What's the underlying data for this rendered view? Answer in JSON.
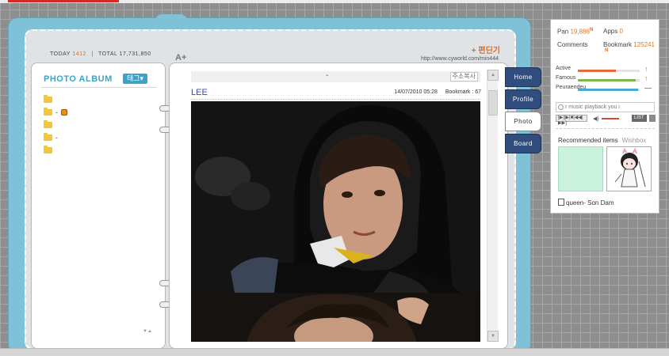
{
  "header": {
    "counter": {
      "today_label": "TODAY",
      "today_value": "1412",
      "total_label": "TOTAL",
      "total_value": "17,731,850"
    },
    "font_size_label": "A+",
    "edit_link": "+ 편딘기",
    "url": "http://www.cyworld.com/min444"
  },
  "album": {
    "title": "PHOTO ALBUM",
    "tag_button": "태그▾",
    "folders": [
      {
        "label": "",
        "icon": "folder-icon"
      },
      {
        "label": "-",
        "icon": "folder-icon",
        "badge": "new-icon"
      },
      {
        "label": "",
        "icon": "folder-icon"
      },
      {
        "label": "-",
        "icon": "folder-icon"
      },
      {
        "label": "",
        "icon": "folder-icon"
      }
    ],
    "scroll_arrows": "▼▲"
  },
  "post": {
    "title": "-",
    "copy_address_button": "주소복사",
    "author": "LEE",
    "date": "14/07/2010 05:28",
    "bookmark": "Bookmark : 67"
  },
  "tabs": [
    {
      "label": "Home",
      "active": false
    },
    {
      "label": "Profile",
      "active": false
    },
    {
      "label": "Photo",
      "active": true
    },
    {
      "label": "Board",
      "active": false
    }
  ],
  "widget": {
    "pan_label": "Pan",
    "pan_value": "19,886",
    "apps_label": "Apps",
    "apps_value": "0",
    "comments_label": "Comments",
    "bookmark_label": "Bookmark",
    "bookmark_value": "125241",
    "new_marker": "N",
    "bars": [
      {
        "label": "Active",
        "fill": 0.62,
        "color": "#e86a3a",
        "trend": "up",
        "trend_color": "#e86a1e"
      },
      {
        "label": "Famous",
        "fill": 0.93,
        "color": "#7bb84a",
        "trend": "up",
        "trend_color": "#e86a1e"
      },
      {
        "label": "Peuraendeu",
        "fill": 0.98,
        "color": "#4aa9d8",
        "trend": "flat",
        "trend_color": "#888888"
      }
    ],
    "music_placeholder": "r music playback you i",
    "player": {
      "controls_label": "[▶||▶|■|◀◀|▶▶]",
      "list_button": "LIST",
      "volume_icon": "speaker-icon"
    },
    "recommended_label": "Recommended items",
    "wishbox_label": "Wishbox",
    "recommended_name": "queen- Son Dam"
  }
}
